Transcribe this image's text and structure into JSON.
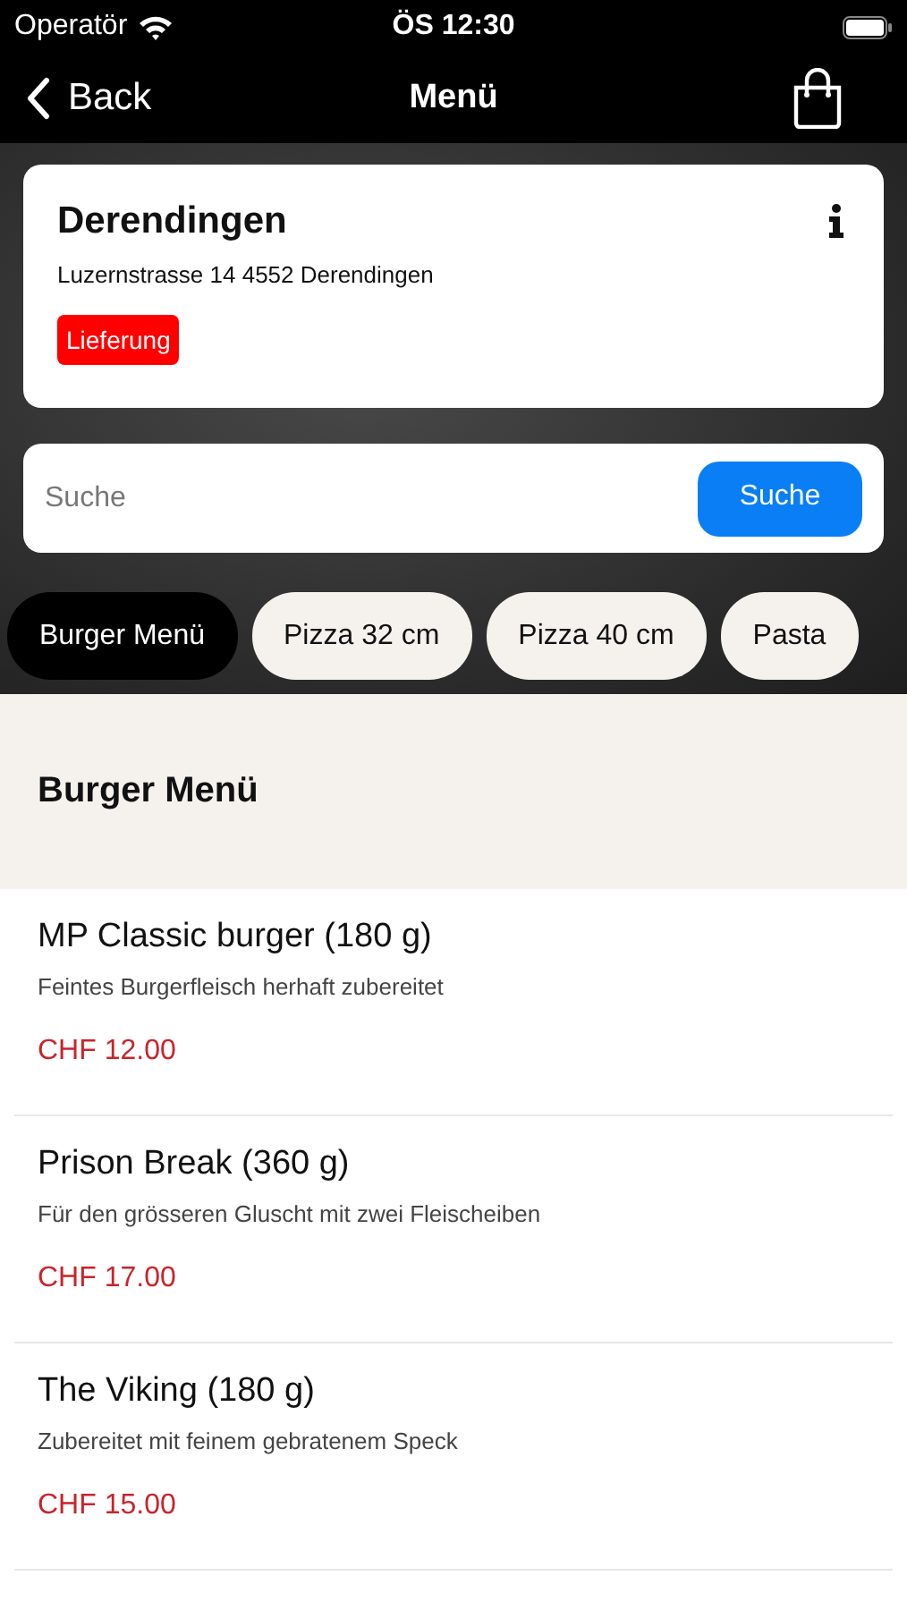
{
  "status_bar": {
    "carrier": "Operatör",
    "time": "ÖS 12:30"
  },
  "nav": {
    "back": "Back",
    "title": "Menü"
  },
  "store": {
    "name": "Derendingen",
    "address": "Luzernstrasse 14 4552 Derendingen",
    "tag": "Lieferung"
  },
  "search": {
    "placeholder": "Suche",
    "button": "Suche"
  },
  "categories": [
    {
      "label": "Burger Menü",
      "selected": true
    },
    {
      "label": "Pizza 32 cm",
      "selected": false
    },
    {
      "label": "Pizza 40 cm",
      "selected": false
    },
    {
      "label": "Pasta",
      "selected": false
    }
  ],
  "section": {
    "title": "Burger Menü"
  },
  "items": [
    {
      "name": "MP Classic burger (180 g)",
      "description": "Feintes Burgerfleisch herhaft zubereitet",
      "price": "CHF 12.00"
    },
    {
      "name": "Prison Break (360 g)",
      "description": "Für den grösseren Gluscht mit zwei Fleischeiben",
      "price": "CHF 17.00"
    },
    {
      "name": "The Viking (180 g)",
      "description": "Zubereitet mit feinem gebratenem Speck",
      "price": "CHF 15.00"
    }
  ]
}
